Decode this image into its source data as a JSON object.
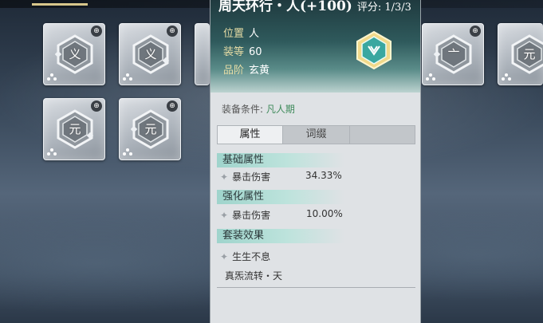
{
  "header": {
    "title": "周天环行・人(+100)",
    "title_right": "评分: 1/3/3"
  },
  "item": {
    "position_label": "位置",
    "position_value": "人",
    "level_label": "装等",
    "level_value": "60",
    "grade_label": "品阶",
    "grade_value": "玄黄",
    "condition_label": "装备条件:",
    "condition_value": "凡人期"
  },
  "tabs": [
    {
      "label": "属性"
    },
    {
      "label": "词缀"
    }
  ],
  "sections": {
    "base": {
      "title": "基础属性",
      "stat_name": "暴击伤害",
      "stat_value": "34.33%"
    },
    "enhance": {
      "title": "强化属性",
      "stat_name": "暴击伤害",
      "stat_value": "10.00%"
    },
    "set": {
      "title": "套装效果",
      "effect_name": "生生不息",
      "set_name": "真炁流转・天"
    }
  },
  "slots": [
    {
      "glyph": "义"
    },
    {
      "glyph": "义"
    },
    {
      "glyph": ""
    },
    {
      "glyph": "亠"
    },
    {
      "glyph": "元"
    },
    {
      "glyph": "元"
    },
    {
      "glyph": "元"
    }
  ],
  "colors": {
    "accent_gold": "#d8c78c",
    "panel_bg": "#dfe2e5",
    "section_teal": "#9fd4cc",
    "condition_green": "#3e8a5a"
  }
}
